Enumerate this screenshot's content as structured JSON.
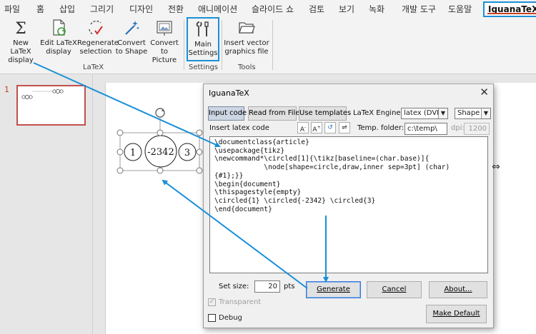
{
  "tabs": [
    "파일",
    "홈",
    "삽입",
    "그리기",
    "디자인",
    "전환",
    "애니메이션",
    "슬라이드 쇼",
    "검토",
    "보기",
    "녹화",
    "개발 도구",
    "도움말",
    "IguanaTeX"
  ],
  "ribbon": {
    "latex_group": {
      "label": "LaTeX",
      "buttons": [
        {
          "line1": "New LaTeX",
          "line2": "display",
          "icon": "sigma-icon"
        },
        {
          "line1": "Edit LaTeX",
          "line2": "display",
          "icon": "edit-document-icon"
        },
        {
          "line1": "Regenerate",
          "line2": "selection",
          "icon": "regenerate-icon"
        },
        {
          "line1": "Convert",
          "line2": "to Shape",
          "icon": "magic-wand-icon"
        },
        {
          "line1": "Convert",
          "line2": "to Picture",
          "icon": "picture-icon"
        }
      ]
    },
    "settings_group": {
      "label": "Settings",
      "button": {
        "line1": "Main",
        "line2": "Settings",
        "icon": "tools-icon"
      }
    },
    "tools_group": {
      "label": "Tools",
      "button": {
        "line1": "Insert vector",
        "line2": "graphics file",
        "icon": "folder-icon"
      }
    }
  },
  "slides": {
    "current_number": "1"
  },
  "shape": {
    "items": [
      "1",
      "-2342",
      "3"
    ]
  },
  "dialog": {
    "title": "IguanaTeX",
    "tabs": {
      "input_code": "Input code",
      "read_from_file": "Read from File",
      "use_templates": "Use templates"
    },
    "engine_label": "LaTeX Engine:",
    "engine_value": "latex (DVI)",
    "output_value": "Shape",
    "insert_label": "Insert latex code",
    "temp_folder_label": "Temp. folder:",
    "temp_folder_value": "c:\\temp\\",
    "dpi_label": "dpi:",
    "dpi_value": "1200",
    "code_lines": [
      "\\documentclass{article}",
      "\\usepackage{tikz}",
      "\\newcommand*\\circled[1]{\\tikz[baseline=(char.base)]{",
      "            \\node[shape=circle,draw,inner sep=3pt] (char)",
      "{#1};}}",
      "\\begin{document}",
      "\\thispagestyle{empty}",
      "\\circled{1} \\circled{-2342} \\circled{3}",
      "\\end{document}"
    ],
    "set_size_label": "Set size:",
    "set_size_value": "20",
    "set_size_unit": "pts",
    "generate": "Generate",
    "cancel": "Cancel",
    "about": "About...",
    "transparent": "Transparent",
    "debug": "Debug",
    "make_default": "Make Default"
  },
  "colors": {
    "accent": "#1a90d6",
    "active_tab_underline": "#c43e1c",
    "thumbnail_border": "#c0504d"
  }
}
